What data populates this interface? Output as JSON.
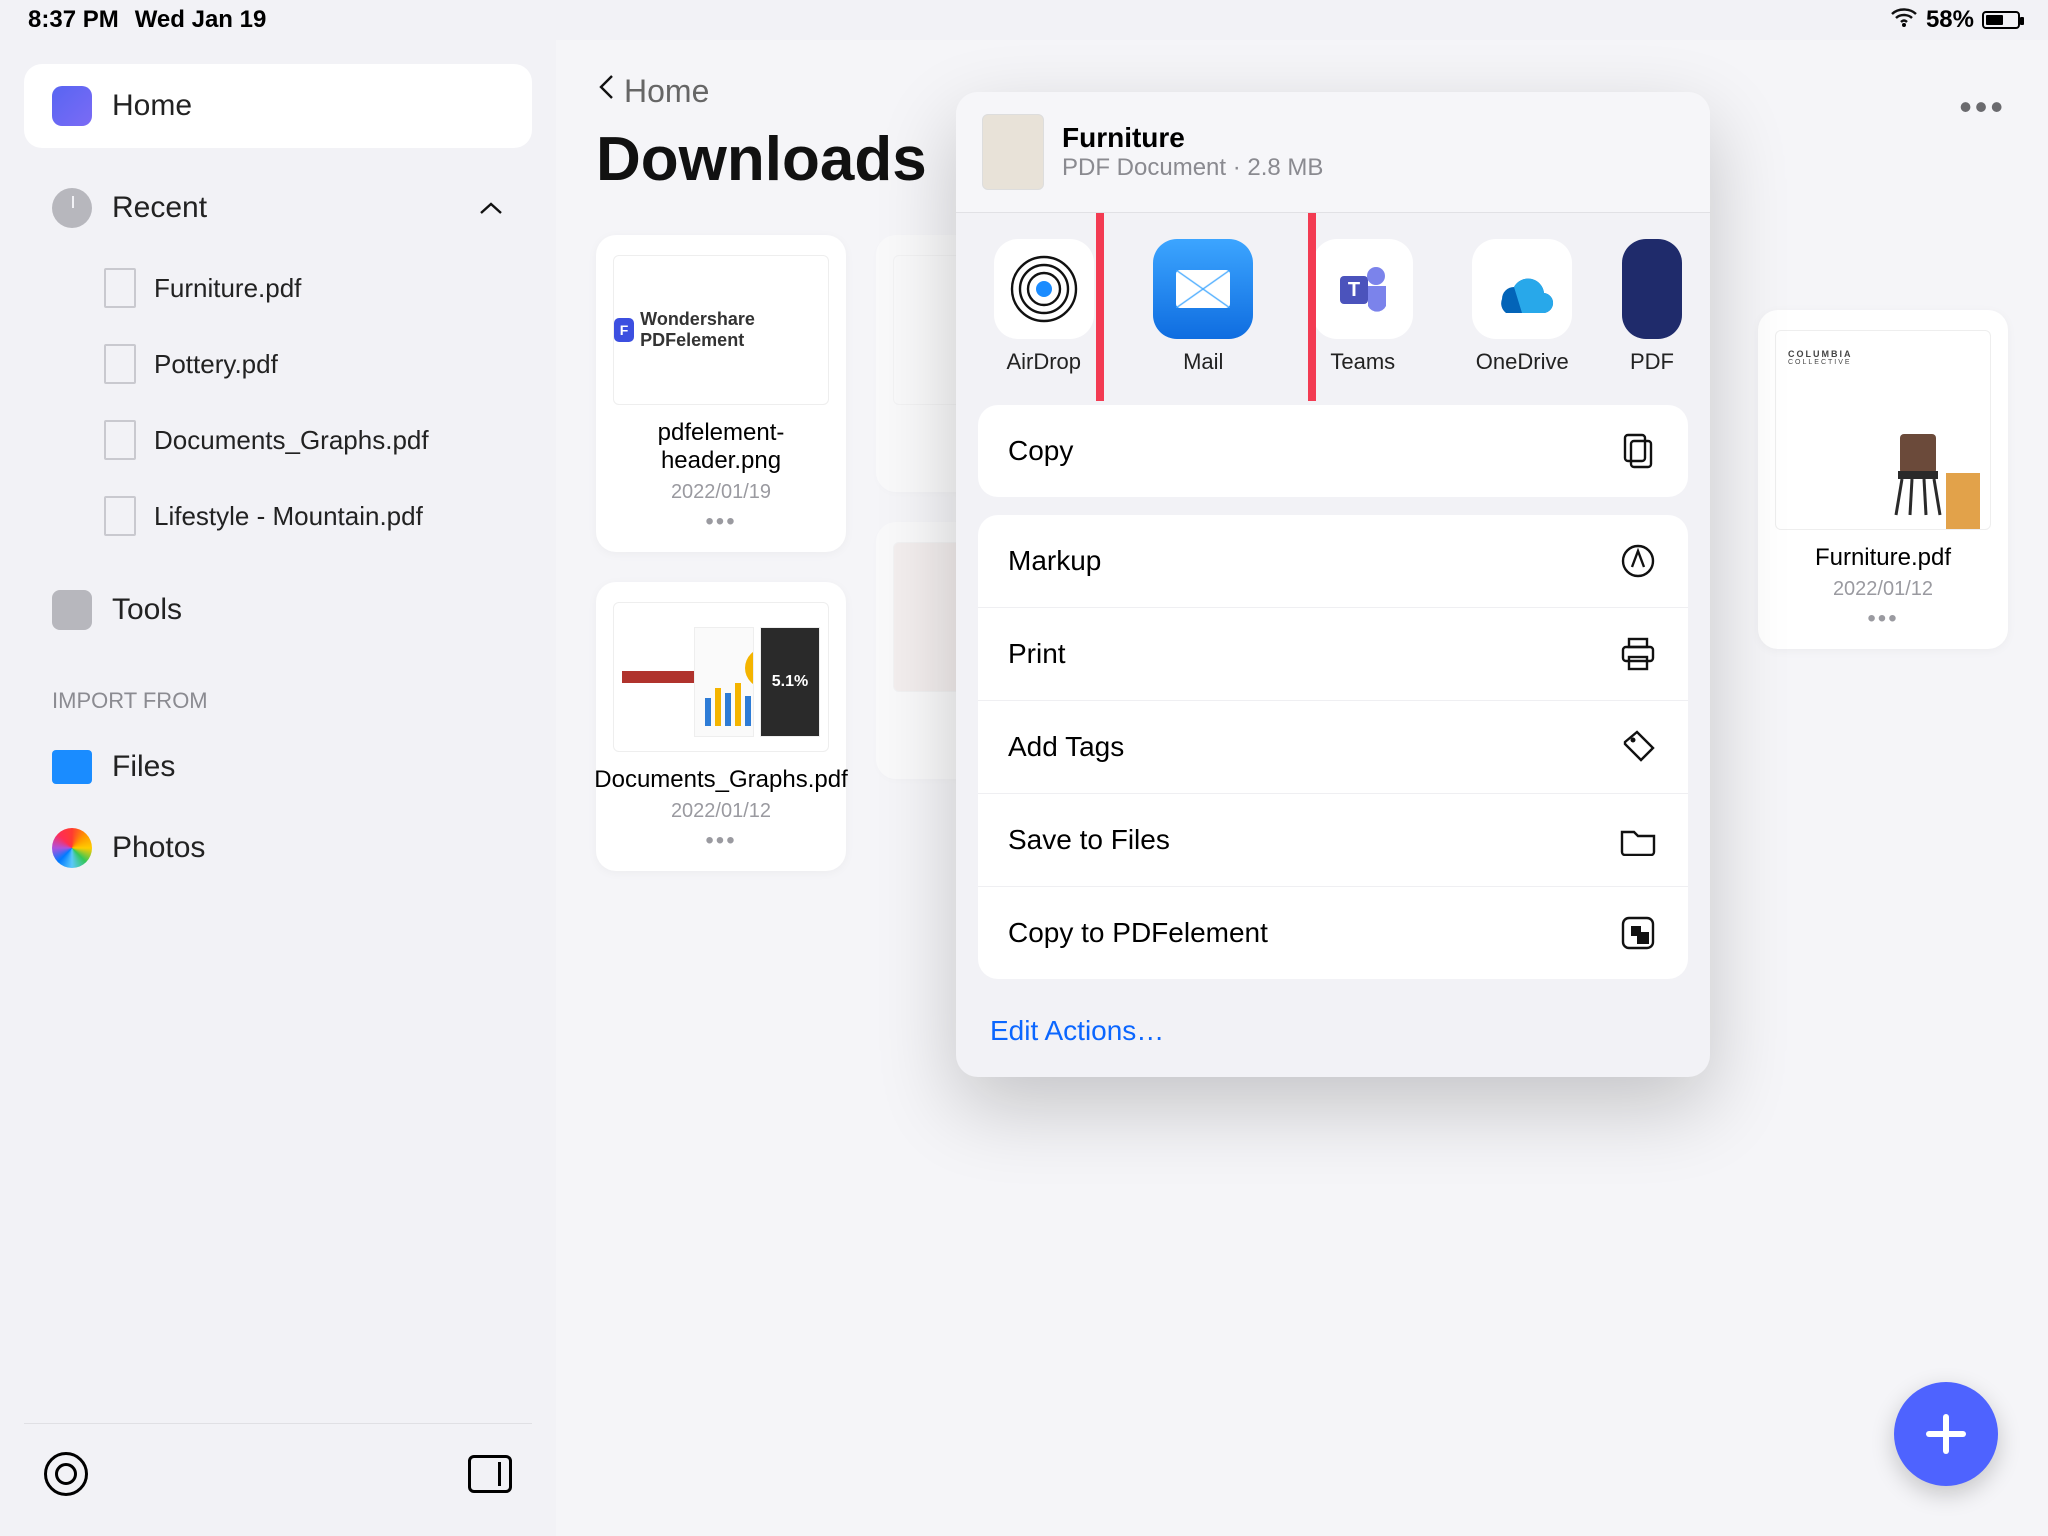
{
  "status": {
    "time": "8:37 PM",
    "date": "Wed Jan 19",
    "battery": "58%"
  },
  "sidebar": {
    "home": "Home",
    "recent": "Recent",
    "recent_items": [
      {
        "label": "Furniture.pdf"
      },
      {
        "label": "Pottery.pdf"
      },
      {
        "label": "Documents_Graphs.pdf"
      },
      {
        "label": "Lifestyle - Mountain.pdf"
      }
    ],
    "tools": "Tools",
    "import_label": "IMPORT FROM",
    "files": "Files",
    "photos": "Photos"
  },
  "breadcrumb": "Home",
  "page_title": "Downloads",
  "files": [
    {
      "name": "pdfelement-header.png",
      "date": "2022/01/19",
      "thumb_text": "Wondershare PDFelement"
    },
    {
      "name": "Documents_Graphs.pdf",
      "date": "2022/01/12",
      "badge": "5.1%"
    },
    {
      "name": "Furniture.pdf",
      "date": "2022/01/12",
      "brand": "COLUMBIA",
      "brand_sub": "COLLECTIVE"
    }
  ],
  "share": {
    "title": "Furniture",
    "subtitle": "PDF Document · 2.8 MB",
    "apps": [
      {
        "label": "AirDrop"
      },
      {
        "label": "Mail"
      },
      {
        "label": "Teams"
      },
      {
        "label": "OneDrive"
      },
      {
        "label": "PDF"
      }
    ],
    "actions_primary": [
      {
        "label": "Copy"
      }
    ],
    "actions": [
      {
        "label": "Markup"
      },
      {
        "label": "Print"
      },
      {
        "label": "Add Tags"
      },
      {
        "label": "Save to Files"
      },
      {
        "label": "Copy to PDFelement"
      }
    ],
    "edit": "Edit Actions…"
  }
}
